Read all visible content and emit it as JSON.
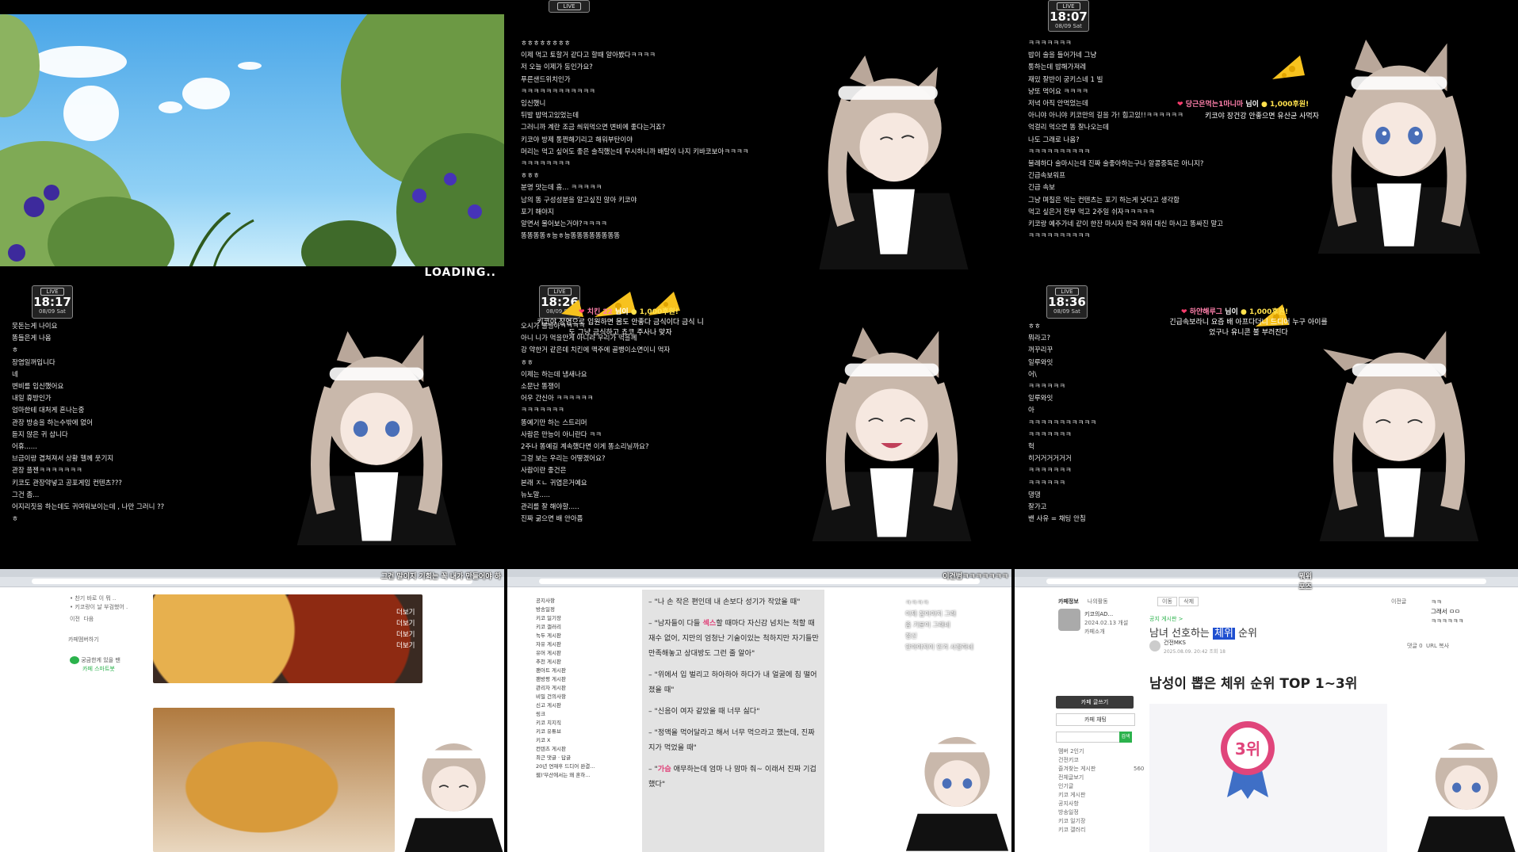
{
  "tile1": {
    "loading_label": "LOADING.."
  },
  "tile2": {
    "clock": {
      "live": "LIVE",
      "time": "",
      "date": ""
    },
    "chat": [
      "ㅎㅎㅎㅎㅎㅎㅎㅎ",
      "이제 먹고 토할거 같다고 할때 알아봤다ㅋㅋㅋㅋ",
      "저 오늘 이제가 동인가요?",
      "푸른샌드위치인가",
      "ㅋㅋㅋㅋㅋㅋㅋㅋㅋㅋㅋㅋ",
      "임신했니",
      "뒤발 밥먹고있었는데",
      "그러니까 계란 조금 씌워먹으면 변비에 좋다는거죠?",
      "키코야 방제 통쩐해기리고 해워부탄이야",
      "머리는 먹고 싶어도 좋은 솔직했는데 무시하니까 배탈이 나지 키바코보아ㅋㅋㅋㅋ",
      "ㅋㅋㅋㅋㅋㅋㅋㅋ",
      "ㅎㅎㅎ",
      "분명 맛는데 흠... ㅋㅋㅋㅋㅋ",
      "남의 똥 구성성분을 알고싶진 않아 키코야",
      "포기 해야지",
      "알면서 물어보는거야?ㅋㅋㅋㅋ",
      "똥똥똥똥ㅎ능ㅎ능똥똥똥똥똥똥똥똥"
    ]
  },
  "tile3": {
    "clock": {
      "live": "LIVE",
      "time": "18:07",
      "date": "08/09 Sat"
    },
    "chat": [
      "ㅋㅋㅋㅋㅋㅋㅋ",
      "밥이 술을 들어가네 그냥",
      "통하는데 밥해가져레",
      "재밌 잘반이 궁키스네 1 빌",
      "냥또 먹어요 ㅋㅋㅋㅋ",
      "저녁 아직 안먹었는데",
      "아니야 아니야 키코만의 길을 가! 힘고있!!ㅋㅋㅋㅋㅋㅋ",
      "억걸리 먹으면 똥 잘나오는데",
      "나도 그래로 나옴?",
      "ㅋㅋㅋㅋㅋㅋㅋㅋㅋㅋ",
      "불례하다 술마시는데 진짜 술좋아하는구나 알콩중독은 아니지?",
      "긴급속보워프",
      "긴급 속보",
      "그냥 며칠은 먹는 컨텐츠는 포기 하는게 낫다고 생각함",
      "먹고 싶은거 전부 먹고 2주일 쉬자ㅋㅋㅋㅋㅋ",
      "키코랑 예주가네 같이 한잔 마시자 한국 와워 대신 마시고 똥싸진 말고",
      "ㅋㅋㅋㅋㅋㅋㅋㅋㅋㅋ"
    ],
    "donation": {
      "name": "당근은먹는1마니마",
      "suffix": "님이",
      "amount": "1,000",
      "unit": "후원!"
    },
    "donation_msg": "키코야 장건강 안좋으면 유산균 사먹자"
  },
  "tile4": {
    "clock": {
      "live": "LIVE",
      "time": "18:17",
      "date": "08/09 Sat"
    },
    "chat": [
      "못돈는게 나이요",
      "똥들은게 나옴",
      "ㅎ",
      "장염일꺼입니다",
      "네",
      "변비를 임신했어요",
      "내일 휴방인가",
      "엄마한테 대처게 혼나는중",
      "관장 방송을 하는수밖에 없어",
      "듣지 않은 귀 삽니다",
      "어휴......",
      "브금이랑 겹쳐져서 상황 헬께 웃기지",
      "관장 플젠ㅋㅋㅋㅋㅋㅋㅋ",
      "키코도 관장약넣고 공포게임 컨텐츠???",
      "그건 좀...",
      "어지리짓을 하는데도 귀여워보이는데 , 나만 그러니 ??",
      "ㅎ"
    ]
  },
  "tile5": {
    "clock": {
      "live": "LIVE",
      "time": "18:26",
      "date": "08/09 Sat"
    },
    "chat": [
      "오시가 불쌍아ㅋㅋㅋㅋ",
      "아니 니가 먹을만게 아니라 우리가 먹을께",
      "강 약한거 같은데 치킨에 맥주에 골뱅이소면이니 먹자",
      "ㅎㅎ",
      "이제는 하는데 냄새나요",
      "소문난 똥쟁이",
      "어우 간신아 ㅋㅋㅋㅋㅋㅋ",
      "ㅋㅋㅋㅋㅋㅋㅋ",
      "똥예기만 하는 스트리머",
      "사람은 만능이 아니란다 ㅋㅋ",
      "2주나 똥예길 계속했다면 이게 똥소리닐까요?",
      "그걸 보는 우리는 어떻겠어요?",
      "사람이란 좋건은",
      "본래 ㅈㄴ 귀엽은거예요",
      "뉴노말.....",
      "관리를 잘 해야할.....",
      "진짜 굶으면 배 안아픔"
    ],
    "donation": {
      "name": "치킨 22",
      "suffix": "님이",
      "amount": "1,000",
      "unit": "후원!"
    },
    "donation_msg_1": "키코야 장염으로 입원하면 몸도 안좋다 금식이다 금식 니",
    "donation_msg_2": "도 그냥 금식하고 쵸코 주사나 맞자"
  },
  "tile6": {
    "clock": {
      "live": "LIVE",
      "time": "18:36",
      "date": "08/09 Sat"
    },
    "chat": [
      "ㅎㅎ",
      "뭐라고?",
      "꺼꾸리꾸",
      "일루와잇",
      "어\\",
      "ㅋㅋㅋㅋㅋㅋ",
      "일루와잇",
      "아",
      "ㅋㅋㅋㅋㅋㅋㅋㅋㅋㅋㅋ",
      "ㅋㅋㅋㅋㅋㅋㅋ",
      "헉",
      "히거거거거거거",
      "ㅋㅋㅋㅋㅋㅋㅋ",
      "ㅋㅋㅋㅋㅋㅋ",
      "댕댕",
      "잘가고",
      "밴 사유 = 채팅 안침"
    ],
    "donation": {
      "name": "하얀해루그",
      "suffix": "님이",
      "amount": "1,000",
      "unit": "후원!"
    },
    "donation_msg_1": "긴급속보라니 요즘 배 아프다더니 드디어 누구 아이를",
    "donation_msg_2": "었구나 유니콘 불 부러진다"
  },
  "tile7": {
    "subtitle": "그건 말이지 기회는 꼭 내가 만들어야 하",
    "side_labels": [
      "더보기",
      "더보기",
      "더보기",
      "더보기"
    ],
    "left_lines": [
      "• 찬기 바로 이 뭐 ..",
      "• 키코랑이 날 부검했어 ."
    ],
    "left_meta": [
      "카페 동보",
      "카페멤버하기"
    ],
    "left_bottom": [
      "궁금한게 있을 땐",
      "카페 스마트봇"
    ],
    "left_small": [
      "이전",
      "다음"
    ]
  },
  "tile8": {
    "subtitle": "이건범ㅋㅋㅋㅋㅋㅋㅋ",
    "side_chat": [
      "ㅋㅋㅋㅋ",
      "이제 잡아야지 그래",
      "좀 기분이 그래네",
      "정신",
      "안아야지이 안겨 사정하네"
    ],
    "menu": [
      "공지사항",
      "방송일정",
      "키코 일기장",
      "키코 갤러리",
      "녹두 게시판",
      "자유 게시판",
      "유머 게시판",
      "추천 게시판",
      "팬아트 게시판",
      "팬방평 게시판",
      "관리자 게시판",
      "비밀 건의사항",
      "신고 게시판",
      "링크",
      "키코 치지직",
      "키코 유튜브",
      "키코 X",
      "컨텐츠 게시판",
      "최근 댓글 · 답글",
      "20년 연재후 드디어 완결...",
      "웹)'부산에서는 왜 혼하..."
    ],
    "quotes": [
      {
        "pre": "\"나 손 작은 편인데 내 손보다 성기가 작았을 때\"",
        "hl": "",
        "post": ""
      },
      {
        "pre": "\"남자들이 다들 ",
        "hl": "섹스",
        "post": "할 때마다 자신감 넘치는 척할 때 재수 없어, 지만의 엄청난 기술이있는 척하지만 자기들만 만족해놓고 상대방도 그런 줄 알아\""
      },
      {
        "pre": "\"위에서 입 벌리고 하아하아 하다가 내 얼굴에 침 떨어졌을 때\"",
        "hl": "",
        "post": ""
      },
      {
        "pre": "\"신음이 여자 같았을 때 너무 싫다\"",
        "hl": "",
        "post": ""
      },
      {
        "pre": "\"정액을 먹어달라고 해서 너무 먹으라고 했는데, 진짜 지가 먹었을 때\"",
        "hl": "",
        "post": ""
      },
      {
        "pre": "\"",
        "hl": "가슴",
        "post": " 애무하는데 엄마 나 맘마 줘~ 이래서 진짜 기겁했다\""
      }
    ]
  },
  "tile9": {
    "subtitle": "뭐위",
    "subtitle2": "포즈",
    "side_chat": [
      "ㅋㅋ",
      "그래서 ㅁㅁ",
      "ㅋㅋㅋㅋㅋㅋ"
    ],
    "cafe_tab": "카페정보",
    "my_tab": "나의활동",
    "cafe_name": "키코의AD...",
    "cafe_meta": [
      "2024.02.13 개설",
      "카페소개"
    ],
    "nav_top": [
      "이동",
      "삭제"
    ],
    "next_label": "이전글",
    "breadcrumb": "공지 게시판 >",
    "article_title_pre": "남녀 선호하는 ",
    "article_title_hl": "체위",
    "article_title_post": " 순위",
    "author": "건전MKS",
    "date": "2025.08.09. 20:42  조회 18",
    "comments": "댓글 0",
    "url_copy": "URL 복사",
    "heading": "남성이 뽑은 체위 순위 TOP 1~3위",
    "badge": "3위",
    "side_menu": [
      "멤버 2인기",
      "건전키코",
      "카페 글쓰기",
      "카페 채팅",
      "즐겨찾는 게시판",
      "전체글보기",
      "인기글",
      "키코 게시판",
      "공지사항",
      "방송일정",
      "키코 일기장",
      "키코 갤러리"
    ],
    "write_btn": "카페 글쓰기",
    "chat_btn": "카페 채팅",
    "search_btn": "검색",
    "count_all": "560"
  },
  "colors": {
    "donation": "#ffe14d",
    "highlight": "#e0457b",
    "badge_pink": "#e0457b",
    "badge_blue": "#3f6fc6"
  }
}
